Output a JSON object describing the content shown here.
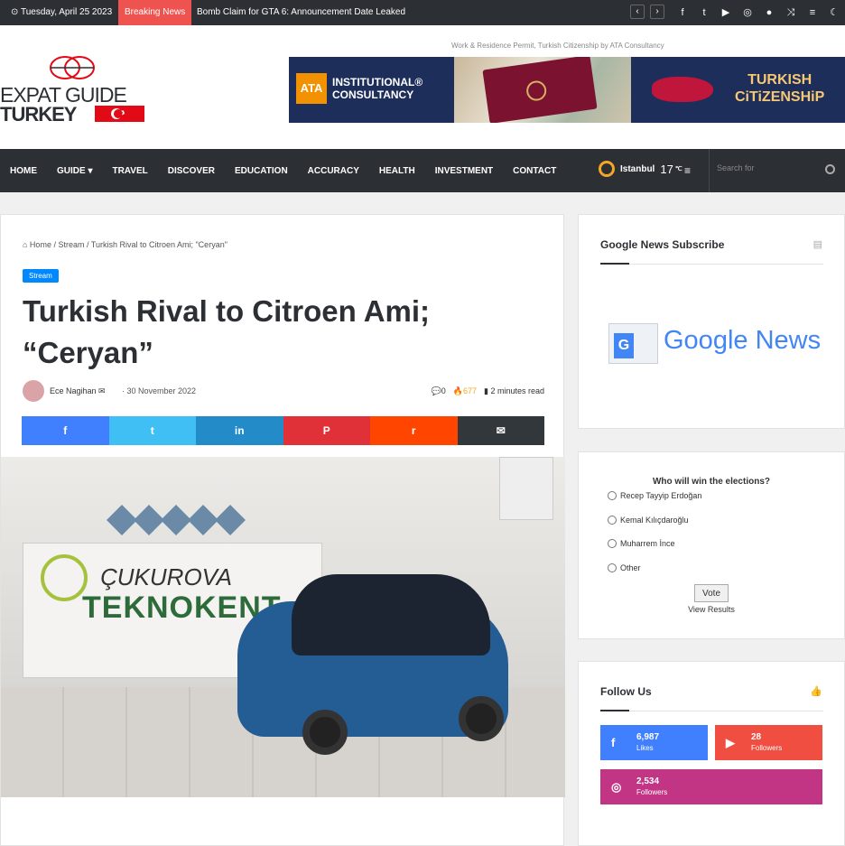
{
  "topbar": {
    "date": "Tuesday, April 25 2023",
    "breaking_label": "Breaking News",
    "ticker": "Bomb Claim for GTA 6: Announcement Date Leaked",
    "icons": [
      "facebook-icon",
      "twitter-icon",
      "youtube-icon",
      "instagram-icon",
      "user-icon",
      "random-icon",
      "menu-icon",
      "dark-mode-icon"
    ]
  },
  "header": {
    "logo_line1": "EXPAT GUIDE",
    "logo_line2": "TURKEY",
    "ad_caption": "Work & Residence Permit, Turkish Citizenship by ATA Consultancy",
    "banner": {
      "ata": "ATA",
      "institutional": "INSTITUTIONAL®",
      "consultancy": "CONSULTANCY",
      "turkish": "TURKISH",
      "citizenship": "CiTiZENSHiP"
    }
  },
  "nav": {
    "items": [
      "HOME",
      "GUIDE ▾",
      "TRAVEL",
      "DISCOVER",
      "EDUCATION",
      "ACCURACY",
      "HEALTH",
      "INVESTMENT",
      "CONTACT"
    ],
    "weather_city": "Istanbul",
    "weather_temp": "17",
    "weather_unit": "℃",
    "search_placeholder": "Search for"
  },
  "article": {
    "breadcrumb": "⌂ Home / Stream / Turkish Rival to Citroen Ami; \"Ceryan\"",
    "category": "Stream",
    "title": "Turkish Rival to Citroen Ami; “Ceryan”",
    "author": "Ece Nagihan ✉",
    "date": "30 November 2022",
    "comments": "💬0",
    "views": "🔥677",
    "read_time": "▮ 2 minutes read",
    "share": [
      {
        "icon": "f",
        "color": "#4080ff"
      },
      {
        "icon": "t",
        "color": "#40bff5"
      },
      {
        "icon": "in",
        "color": "#238cc8"
      },
      {
        "icon": "P",
        "color": "#e13138"
      },
      {
        "icon": "r",
        "color": "#ff4500"
      },
      {
        "icon": "✉",
        "color": "#32373c"
      }
    ],
    "hero_sign_line1": "ÇUKUROVA",
    "hero_sign_line2": "TEKNOKENT"
  },
  "sidebar": {
    "google_news": {
      "title": "Google News Subscribe",
      "brand_g": "G",
      "brand_text": "Google News"
    },
    "poll": {
      "question": "Who will win the elections?",
      "options": [
        "Recep Tayyip Erdoğan",
        "Kemal Kılıçdaroğlu",
        "Muharrem İnce",
        "Other"
      ],
      "vote_label": "Vote",
      "results_label": "View Results"
    },
    "follow": {
      "title": "Follow Us",
      "tiles": [
        {
          "name": "facebook",
          "count": "6,987",
          "label": "Likes",
          "color": "#4080ff",
          "icon": "f"
        },
        {
          "name": "youtube",
          "count": "28",
          "label": "Followers",
          "color": "#ef4e41",
          "icon": "▶"
        },
        {
          "name": "instagram",
          "count": "2,534",
          "label": "Followers",
          "color": "#c13584",
          "icon": "◎"
        }
      ]
    }
  },
  "colors": {
    "dark": "#2c2f34",
    "accent": "#0088ff",
    "breaking": "#ef5350"
  }
}
